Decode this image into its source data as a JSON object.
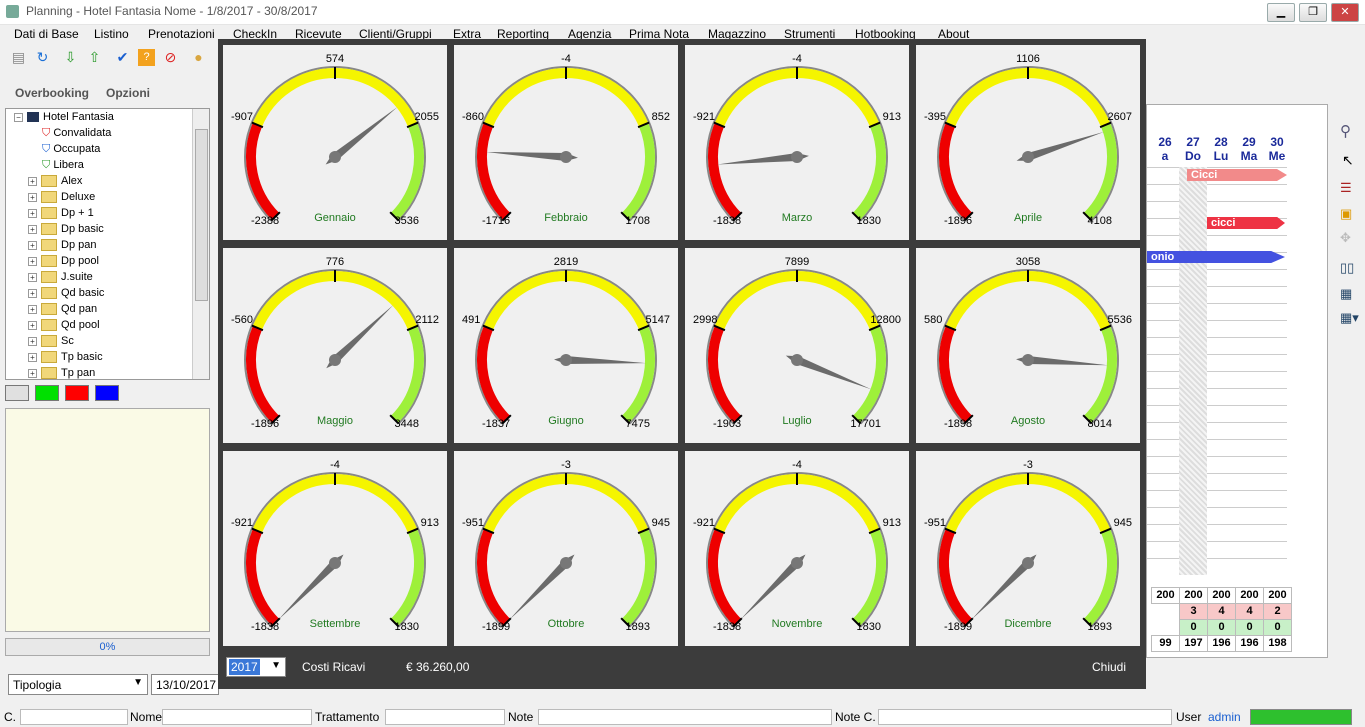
{
  "window": {
    "title": "Planning - Hotel Fantasia Nome - 1/8/2017 - 30/8/2017"
  },
  "menu": [
    "Dati di Base",
    "Listino",
    "Prenotazioni",
    "CheckIn",
    "Ricevute",
    "Clienti/Gruppi",
    "Extra",
    "Reporting",
    "Agenzia",
    "Prima Nota",
    "Magazzino",
    "Strumenti",
    "Hotbooking",
    "About"
  ],
  "tabs": {
    "overbooking": "Overbooking",
    "opzioni": "Opzioni"
  },
  "tree": {
    "root": "Hotel Fantasia",
    "status": [
      "Convalidata",
      "Occupata",
      "Libera"
    ],
    "folders": [
      "Alex",
      "Deluxe",
      "Dp + 1",
      "Dp basic",
      "Dp pan",
      "Dp pool",
      "J.suite",
      "Qd basic",
      "Qd pan",
      "Qd pool",
      "Sc",
      "Tp basic",
      "Tp pan"
    ]
  },
  "swatches": [
    "#e0e0e0",
    "#00e000",
    "#ff0000",
    "#0000ff"
  ],
  "progress": {
    "label": "0%",
    "value": 0
  },
  "filter": {
    "tipologia": "Tipologia",
    "date": "13/10/2017"
  },
  "calendar": {
    "days": [
      {
        "num": "26",
        "dow": "a"
      },
      {
        "num": "27",
        "dow": "Do"
      },
      {
        "num": "28",
        "dow": "Lu"
      },
      {
        "num": "29",
        "dow": "Ma"
      },
      {
        "num": "30",
        "dow": "Me"
      }
    ],
    "bookings": [
      "Cicci",
      "cicci",
      "onio"
    ],
    "totals": [
      [
        "200",
        "200",
        "200",
        "200",
        "200"
      ],
      [
        "3",
        "4",
        "4",
        "2"
      ],
      [
        "0",
        "0",
        "0",
        "0"
      ],
      [
        "99",
        "197",
        "196",
        "196",
        "198"
      ]
    ]
  },
  "gauges": [
    {
      "month": "Gennaio",
      "top": "574",
      "left": "-907",
      "right": "2055",
      "bmin": "-2388",
      "bmax": "3536",
      "min": -2388,
      "max": 3536,
      "value": 1700
    },
    {
      "month": "Febbraio",
      "top": "-4",
      "left": "-860",
      "right": "852",
      "bmin": "-1716",
      "bmax": "1708",
      "min": -1716,
      "max": 1708,
      "value": -1100
    },
    {
      "month": "Marzo",
      "top": "-4",
      "left": "-921",
      "right": "913",
      "bmin": "-1838",
      "bmax": "1830",
      "min": -1838,
      "max": 1830,
      "value": -1300
    },
    {
      "month": "Aprile",
      "top": "1106",
      "left": "-395",
      "right": "2607",
      "bmin": "-1896",
      "bmax": "4108",
      "min": -1896,
      "max": 4108,
      "value": 2700
    },
    {
      "month": "Maggio",
      "top": "776",
      "left": "-560",
      "right": "2112",
      "bmin": "-1896",
      "bmax": "3448",
      "min": -1896,
      "max": 3448,
      "value": 1700
    },
    {
      "month": "Giugno",
      "top": "2819",
      "left": "491",
      "right": "5147",
      "bmin": "-1837",
      "bmax": "7475",
      "min": -1837,
      "max": 7475,
      "value": 6000
    },
    {
      "month": "Luglio",
      "top": "7899",
      "left": "2998",
      "right": "12800",
      "bmin": "-1903",
      "bmax": "17701",
      "min": -1903,
      "max": 17701,
      "value": 16000
    },
    {
      "month": "Agosto",
      "top": "3058",
      "left": "580",
      "right": "5536",
      "bmin": "-1898",
      "bmax": "8014",
      "min": -1898,
      "max": 8014,
      "value": 6500
    },
    {
      "month": "Settembre",
      "top": "-4",
      "left": "-921",
      "right": "913",
      "bmin": "-1838",
      "bmax": "1830",
      "min": -1838,
      "max": 1830,
      "value": -1838
    },
    {
      "month": "Ottobre",
      "top": "-3",
      "left": "-951",
      "right": "945",
      "bmin": "-1899",
      "bmax": "1893",
      "min": -1899,
      "max": 1893,
      "value": -1899
    },
    {
      "month": "Novembre",
      "top": "-4",
      "left": "-921",
      "right": "913",
      "bmin": "-1838",
      "bmax": "1830",
      "min": -1838,
      "max": 1830,
      "value": -1838
    },
    {
      "month": "Dicembre",
      "top": "-3",
      "left": "-951",
      "right": "945",
      "bmin": "-1899",
      "bmax": "1893",
      "min": -1899,
      "max": 1893,
      "value": -1899
    }
  ],
  "footer": {
    "year": "2017",
    "label": "Costi Ricavi",
    "total": "€ 36.260,00",
    "close": "Chiudi"
  },
  "status": {
    "c": "C.",
    "nome": "Nome",
    "trattamento": "Trattamento",
    "note": "Note",
    "notec": "Note C.",
    "user": "User",
    "admin": "admin"
  },
  "colors": {
    "red": "#ee0000",
    "yellow": "#f5f500",
    "green": "#9ef03a",
    "overlay": "#3c3c3c"
  }
}
